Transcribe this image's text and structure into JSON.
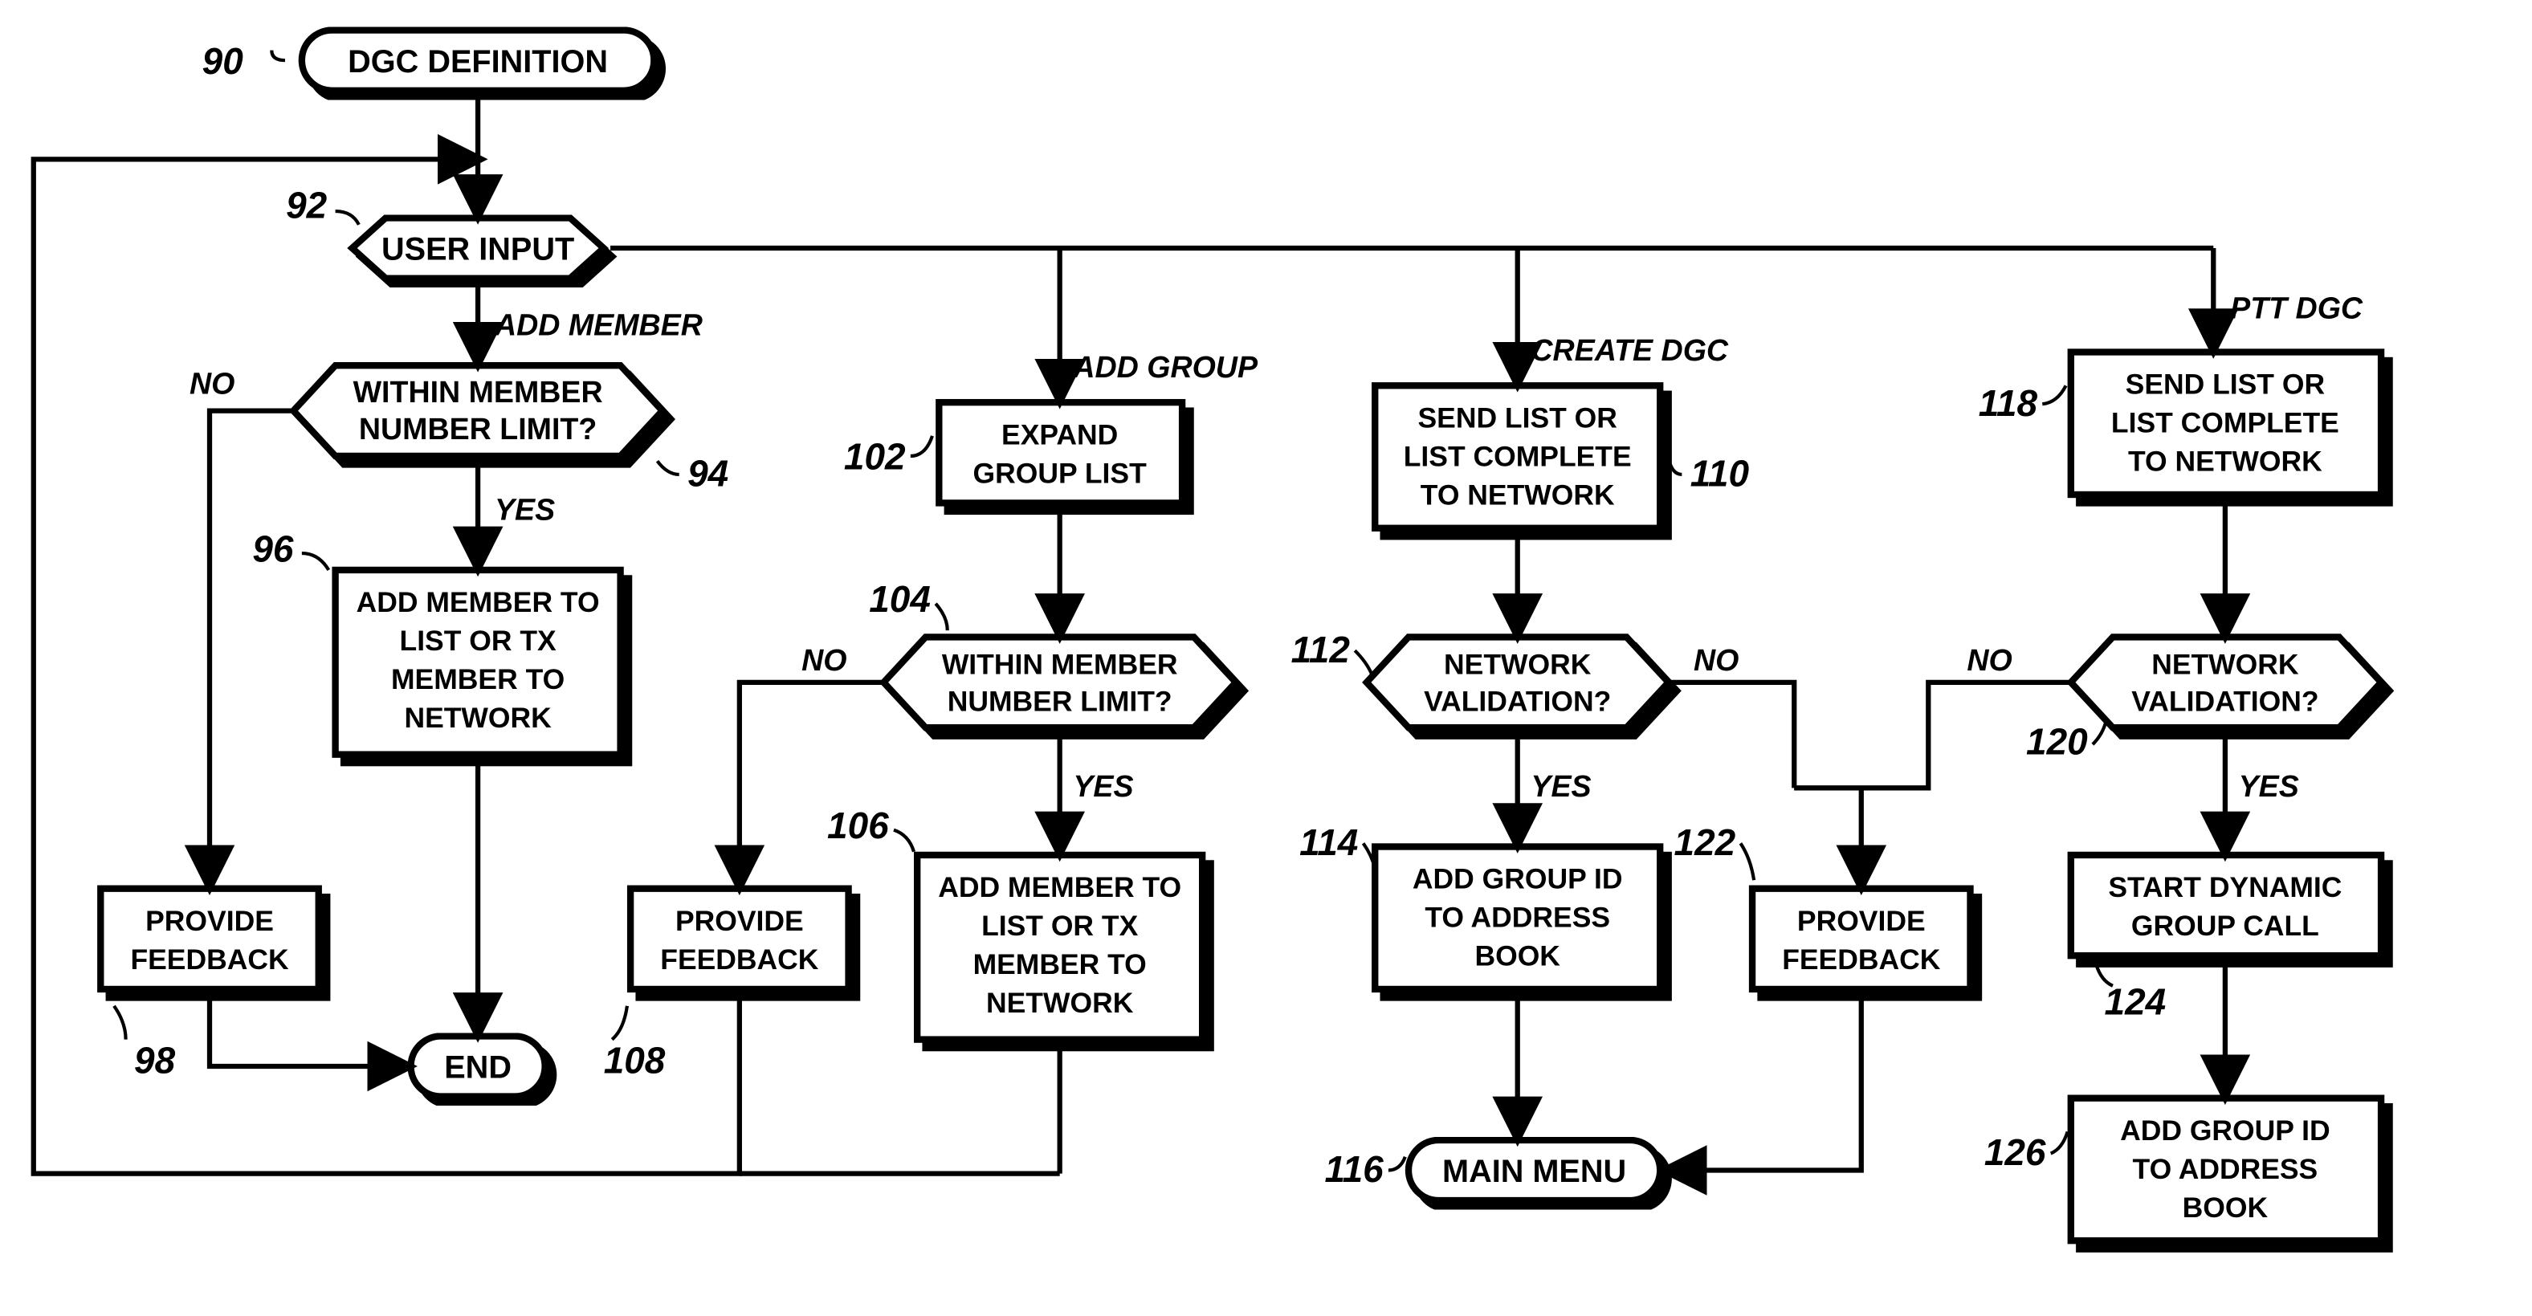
{
  "nodes": {
    "n90": "DGC DEFINITION",
    "n92": "USER INPUT",
    "n94a": "WITHIN MEMBER",
    "n94b": "NUMBER LIMIT?",
    "n96a": "ADD MEMBER TO",
    "n96b": "LIST OR TX",
    "n96c": "MEMBER TO",
    "n96d": "NETWORK",
    "n98a": "PROVIDE",
    "n98b": "FEEDBACK",
    "end": "END",
    "n102a": "EXPAND",
    "n102b": "GROUP LIST",
    "n104a": "WITHIN MEMBER",
    "n104b": "NUMBER LIMIT?",
    "n106a": "ADD MEMBER TO",
    "n106b": "LIST OR TX",
    "n106c": "MEMBER TO",
    "n106d": "NETWORK",
    "n108a": "PROVIDE",
    "n108b": "FEEDBACK",
    "n110a": "SEND LIST OR",
    "n110b": "LIST COMPLETE",
    "n110c": "TO NETWORK",
    "n112a": "NETWORK",
    "n112b": "VALIDATION?",
    "n114a": "ADD GROUP ID",
    "n114b": "TO ADDRESS",
    "n114c": "BOOK",
    "n116": "MAIN MENU",
    "n118a": "SEND LIST OR",
    "n118b": "LIST COMPLETE",
    "n118c": "TO NETWORK",
    "n120a": "NETWORK",
    "n120b": "VALIDATION?",
    "n122a": "PROVIDE",
    "n122b": "FEEDBACK",
    "n124a": "START DYNAMIC",
    "n124b": "GROUP CALL",
    "n126a": "ADD GROUP ID",
    "n126b": "TO ADDRESS",
    "n126c": "BOOK"
  },
  "edges": {
    "add_member": "ADD MEMBER",
    "add_group": "ADD GROUP",
    "create_dgc": "CREATE DGC",
    "ptt_dgc": "PTT DGC",
    "yes": "YES",
    "no": "NO"
  },
  "refs": {
    "r90": "90",
    "r92": "92",
    "r94": "94",
    "r96": "96",
    "r98": "98",
    "r102": "102",
    "r104": "104",
    "r106": "106",
    "r108": "108",
    "r110": "110",
    "r112": "112",
    "r114": "114",
    "r116": "116",
    "r118": "118",
    "r120": "120",
    "r122": "122",
    "r124": "124",
    "r126": "126"
  }
}
